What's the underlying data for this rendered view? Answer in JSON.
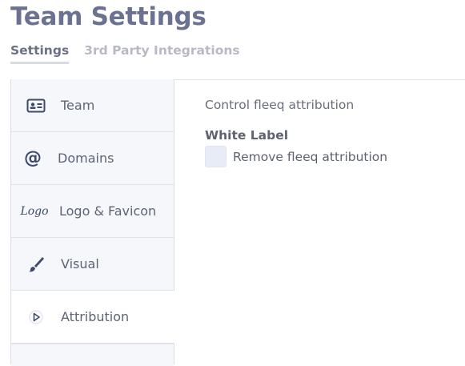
{
  "page": {
    "title": "Team Settings"
  },
  "tabs": [
    {
      "label": "Settings",
      "active": true
    },
    {
      "label": "3rd Party Integrations",
      "active": false
    }
  ],
  "sidebar": {
    "items": [
      {
        "label": "Team",
        "icon": "id-card-icon"
      },
      {
        "label": "Domains",
        "icon": "at-sign-icon"
      },
      {
        "label": "Logo & Favicon",
        "icon": "logo-icon",
        "icon_text": "Logo"
      },
      {
        "label": "Visual",
        "icon": "paintbrush-icon"
      },
      {
        "label": "Attribution",
        "icon": "fleeq-play-icon",
        "active": true
      }
    ]
  },
  "content": {
    "heading": "Control fleeq attribution",
    "section_label": "White Label",
    "checkbox": {
      "label": "Remove fleeq attribution",
      "checked": false
    }
  },
  "colors": {
    "title": "#6b7291",
    "sidebar_bg": "#f6f7fb",
    "checkbox_bg": "#e8ecf7",
    "icon": "#3d4a6b"
  }
}
